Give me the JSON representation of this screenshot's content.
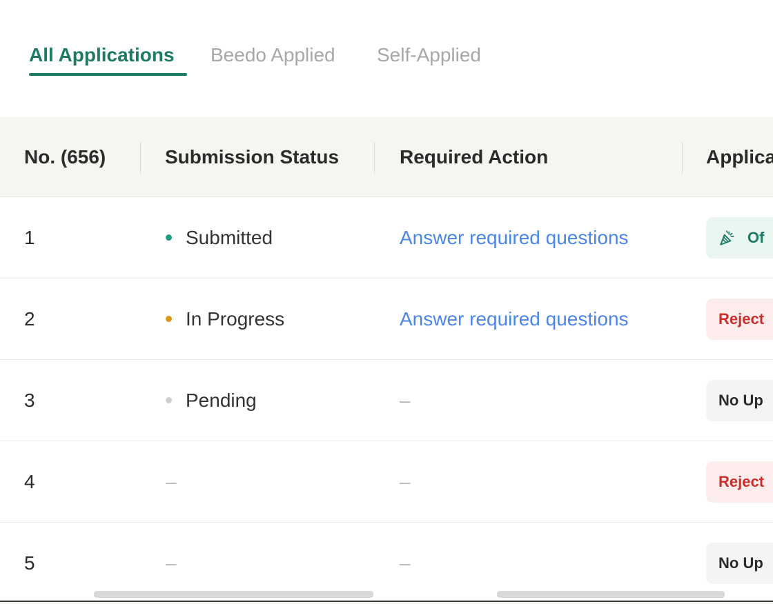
{
  "tabs": [
    {
      "label": "All Applications",
      "active": true
    },
    {
      "label": "Beedo Applied",
      "active": false
    },
    {
      "label": "Self-Applied",
      "active": false
    }
  ],
  "table": {
    "columns": [
      "No. (656)",
      "Submission Status",
      "Required Action",
      "Applica"
    ],
    "rows": [
      {
        "no": "1",
        "status": "Submitted",
        "status_color": "#1f9d7e",
        "action": "Answer required questions",
        "app_status": "Of",
        "app_type": "offer"
      },
      {
        "no": "2",
        "status": "In Progress",
        "status_color": "#d99a1a",
        "action": "Answer required questions",
        "app_status": "Reject",
        "app_type": "reject"
      },
      {
        "no": "3",
        "status": "Pending",
        "status_color": "#cfcfcf",
        "action": "–",
        "app_status": "No Up",
        "app_type": "none"
      },
      {
        "no": "4",
        "status": "–",
        "status_color": "",
        "action": "–",
        "app_status": "Reject",
        "app_type": "reject"
      },
      {
        "no": "5",
        "status": "–",
        "status_color": "",
        "action": "–",
        "app_status": "No Up",
        "app_type": "none"
      }
    ]
  },
  "colors": {
    "accent": "#1f7a63",
    "link": "#4a86e8",
    "reject": "#c9302c"
  },
  "icons": {
    "offer": "party-popper-icon"
  }
}
